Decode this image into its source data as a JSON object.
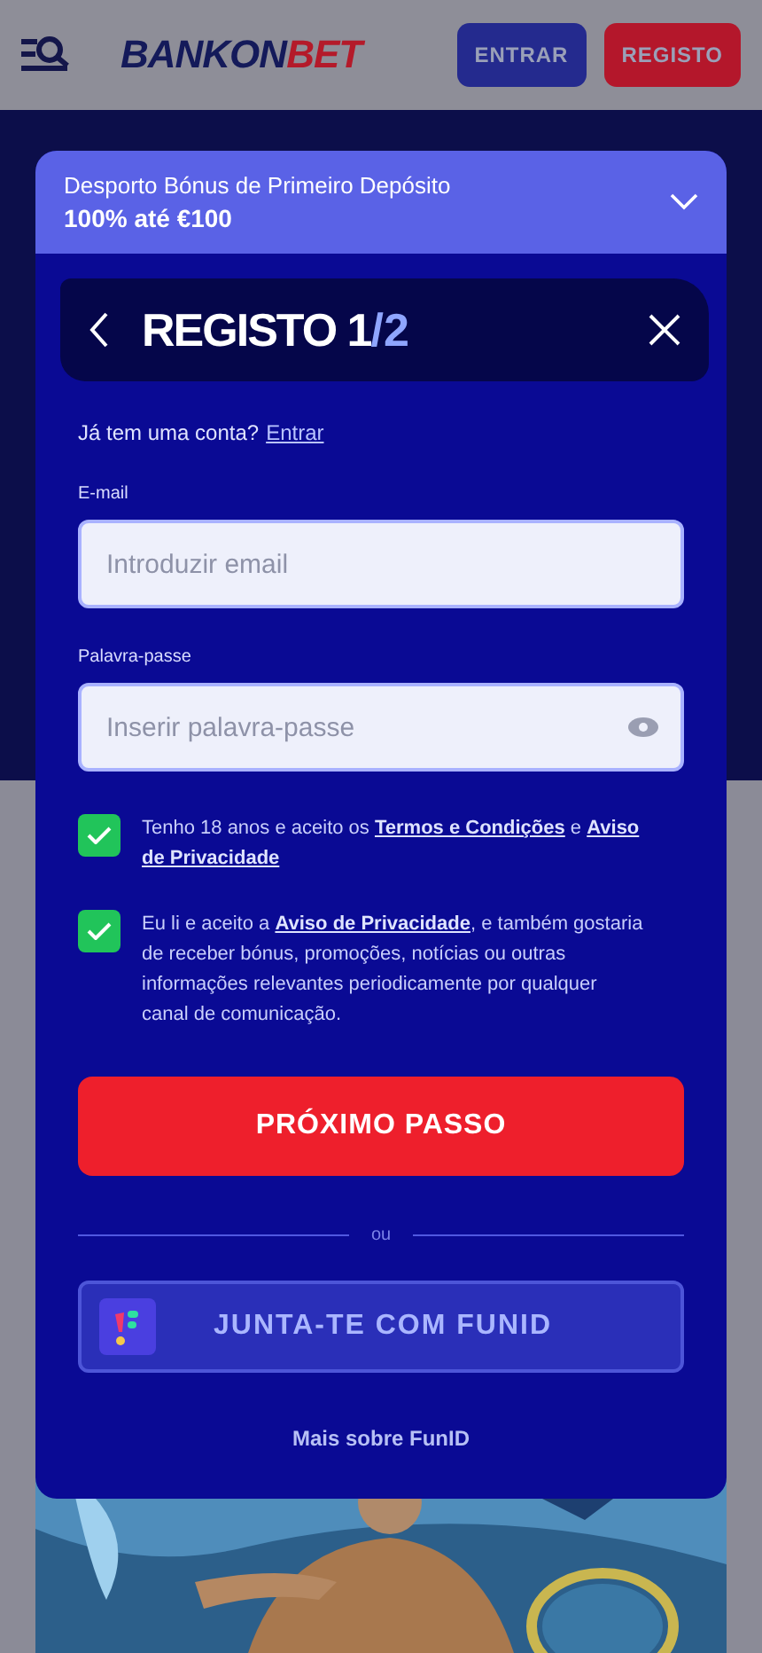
{
  "header": {
    "logo": {
      "part_1": "BANKON",
      "part_2": "BET"
    },
    "buttons": [
      {
        "label": "ENTRAR",
        "kind": "login"
      },
      {
        "label": "REGISTO",
        "kind": "register"
      }
    ]
  },
  "modal": {
    "bonus": {
      "title": "Desporto Bónus de Primeiro Depósito",
      "amount": "100% até €100",
      "expanded": false
    },
    "heading": {
      "title": "REGISTO 1",
      "step_total": "/2"
    },
    "account_prompt": {
      "text": "Já tem uma conta?",
      "link": "Entrar"
    },
    "fields": [
      {
        "label": "E-mail",
        "placeholder": "Introduzir email",
        "kind": "email"
      },
      {
        "label": "Palavra-passe",
        "placeholder": "Inserir palavra-passe",
        "kind": "password"
      }
    ],
    "consents": [
      {
        "checked": true,
        "text": "Tenho 18 anos e aceito os **Termos e Condições** e **Aviso de Privacidade**"
      },
      {
        "checked": true,
        "text": "Eu li e aceito a **Aviso de Privacidade**, e também gostaria de receber bónus, promoções, notícias ou outras informações relevantes periodicamente por qualquer canal de comunicação."
      }
    ],
    "submit": "PRÓXIMO PASSO",
    "divider": "ou",
    "funid_button": "JUNTA-TE COM FUNID",
    "funid_link": "Mais sobre FunID"
  }
}
